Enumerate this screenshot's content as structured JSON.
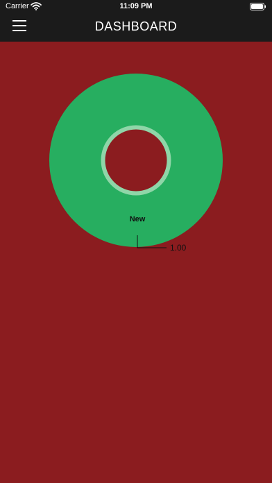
{
  "status_bar": {
    "carrier": "Carrier",
    "time": "11:09 PM",
    "wifi_icon": "wifi-icon",
    "battery_icon": "battery-icon"
  },
  "header": {
    "title": "DASHBOARD",
    "menu_icon": "hamburger-menu-icon"
  },
  "colors": {
    "header_bg": "#1b1b1b",
    "page_bg": "#8b1c1f",
    "slice_green": "#27ae60",
    "inner_ring": "#8fd6a8"
  },
  "chart_data": {
    "type": "pie",
    "categories": [
      "New"
    ],
    "values": [
      1.0
    ],
    "value_labels": [
      "1.00"
    ]
  }
}
